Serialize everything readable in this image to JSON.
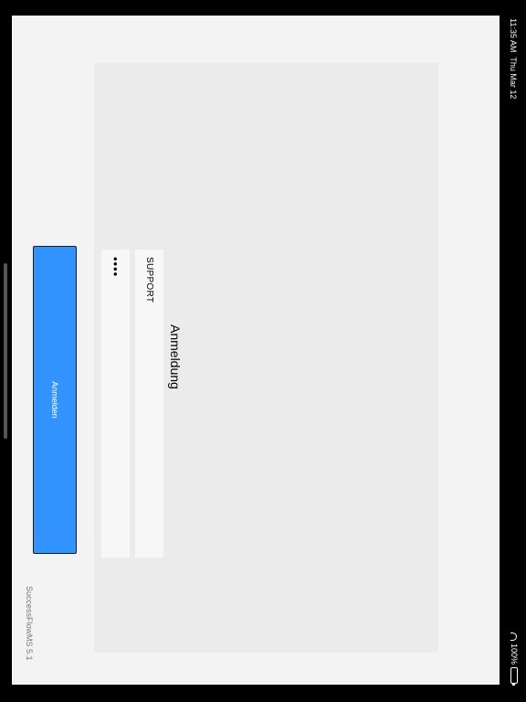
{
  "status_bar": {
    "time": "11:35 AM",
    "date": "Thu Mar 12",
    "battery": "100%"
  },
  "login": {
    "title": "Anmeldung",
    "username_value": "SUPPORT",
    "password_value": "••••",
    "submit_label": "Anmelden"
  },
  "footer": {
    "version": "SuccessFlowMS 5.1"
  },
  "colors": {
    "primary_button": "#3293fe",
    "window_background": "#f3f3f3",
    "panel_background": "#ebebeb",
    "field_background": "#f7f7f7"
  }
}
